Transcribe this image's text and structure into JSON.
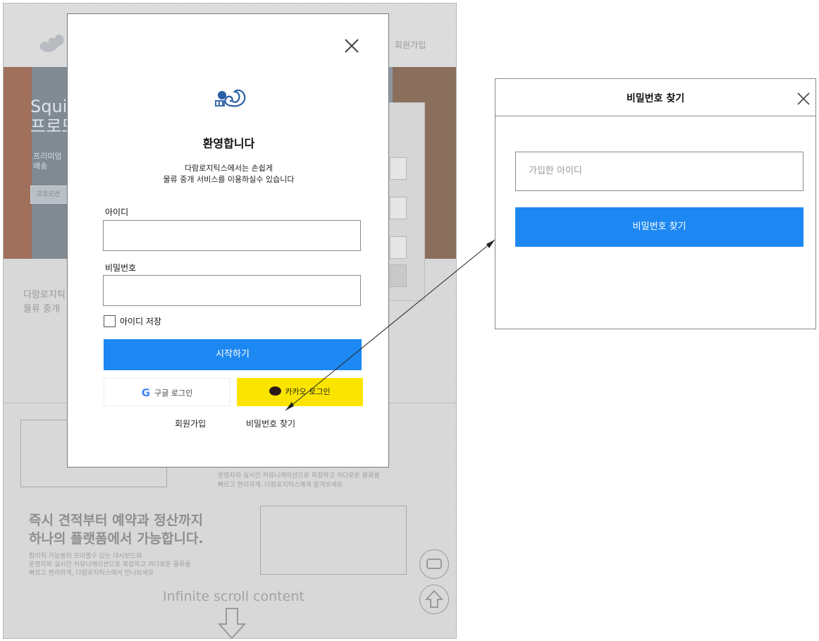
{
  "background_page": {
    "header_signup": "회원가입",
    "hero_title": "Squi\n프로모",
    "hero_sub": "프리미엄\n배송",
    "hero_search": "프로모션",
    "intro_text": "다람로지틱\n물류 중개",
    "small_text_1": "운영자와 실시간 커뮤니케이션으로 복잡하고 까다로운 물류를\n빠르고 편리하게. 다람로지틱스에게 맡겨보세요",
    "heading_2": "즉시 견적부터 예약과 정산까지\n하나의 플랫폼에서 가능합니다.",
    "small_text_2": "합리적 가능범위 모아볼수 있는 대시보드와\n운영자와 실시간 커뮤니케이션으로 복잡하고 까다로운 물류를\n빠르고 편리하게, 다람로지틱스에서 만나보세요",
    "infinite_scroll": "Infinite scroll content"
  },
  "login_modal": {
    "welcome": "환영합니다",
    "description": "다람로지틱스에서는 손쉽게\n물류 중개 서비스를 이용하실수 있습니다",
    "id_label": "아이디",
    "password_label": "비밀번호",
    "remember_id": "아이디 저장",
    "start_button": "시작하기",
    "google_login": "구글 로그인",
    "kakao_login": "카카오 로그인",
    "signup_link": "회원가입",
    "find_password_link": "비밀번호 찾기"
  },
  "password_panel": {
    "title": "비밀번호 찾기",
    "input_placeholder": "가입한 아이디",
    "button": "비밀번호 찾기"
  },
  "colors": {
    "primary": "#1e88f2",
    "kakao": "#fbe500",
    "overlay": "#d8d8d8"
  }
}
